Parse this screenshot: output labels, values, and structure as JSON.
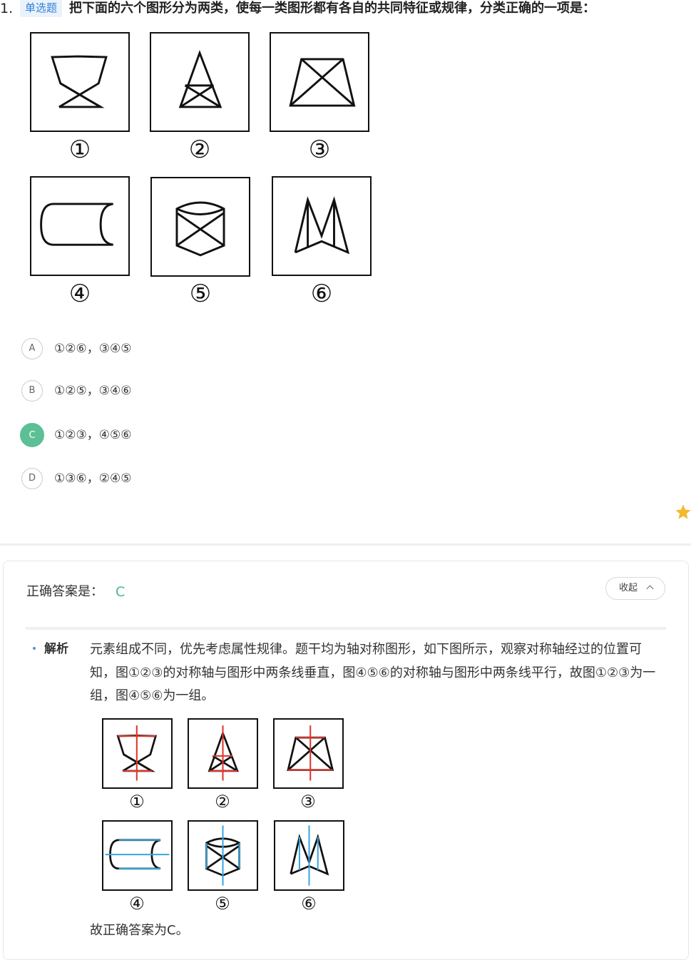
{
  "question": {
    "number": "1.",
    "type_tag": "单选题",
    "text": "把下面的六个图形分为两类，使每一类图形都有各自的共同特征或规律，分类正确的一项是："
  },
  "figures": {
    "labels": [
      "①",
      "②",
      "③",
      "④",
      "⑤",
      "⑥"
    ]
  },
  "options": [
    {
      "letter": "A",
      "text": "①②⑥，③④⑤",
      "selected": false
    },
    {
      "letter": "B",
      "text": "①②⑤，③④⑥",
      "selected": false
    },
    {
      "letter": "C",
      "text": "①②③，④⑤⑥",
      "selected": true
    },
    {
      "letter": "D",
      "text": "①③⑥，②④⑤",
      "selected": false
    }
  ],
  "favorite": {
    "icon": "star-icon",
    "color": "#f5b82e"
  },
  "answer": {
    "label": "正确答案是：",
    "value": "C",
    "collapse_label": "收起",
    "value_color": "#4fb68a"
  },
  "analysis": {
    "label": "解析",
    "text": "元素组成不同，优先考虑属性规律。题干均为轴对称图形，如下图所示，观察对称轴经过的位置可知，图①②③的对称轴与图形中两条线垂直，图④⑤⑥的对称轴与图形中两条线平行，故图①②③为一组，图④⑤⑥为一组。",
    "figure_labels": [
      "①",
      "②",
      "③",
      "④",
      "⑤",
      "⑥"
    ],
    "conclusion": "故正确答案为C。",
    "axis_colors": {
      "perpendicular": "#e0342a",
      "parallel": "#3aa6dc"
    }
  },
  "colors": {
    "correct": "#5cbf95",
    "tag_bg": "#eaf3fc",
    "tag_text": "#2f7fd8"
  }
}
